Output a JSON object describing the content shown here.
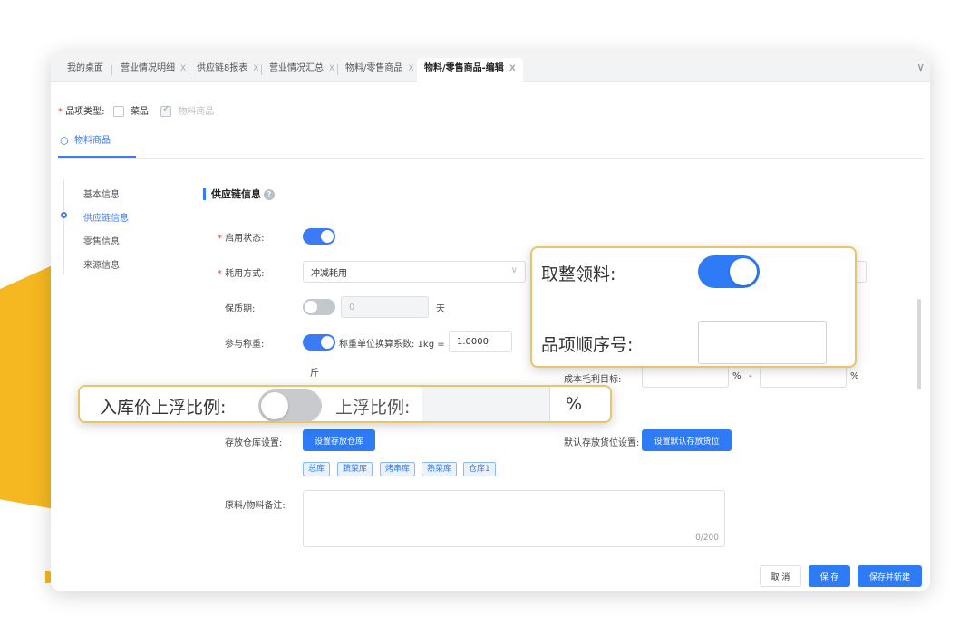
{
  "tabs": [
    {
      "label": "我的桌面",
      "closable": false
    },
    {
      "label": "营业情况明细",
      "closable": true
    },
    {
      "label": "供应链8报表",
      "closable": true
    },
    {
      "label": "营业情况汇总",
      "closable": true
    },
    {
      "label": "物料/零售商品",
      "closable": true
    },
    {
      "label": "物料/零售商品-编辑",
      "closable": true,
      "active": true
    }
  ],
  "tab_close": "X",
  "category": {
    "label": "品项类型:",
    "options": [
      {
        "label": "菜品",
        "checked": false
      },
      {
        "label": "物料商品",
        "checked": true,
        "disabled": true
      }
    ]
  },
  "subtab": {
    "label": "物料商品"
  },
  "anchors": [
    {
      "label": "基本信息"
    },
    {
      "label": "供应链信息",
      "active": true
    },
    {
      "label": "零售信息"
    },
    {
      "label": "来源信息"
    }
  ],
  "section": {
    "title": "供应链信息"
  },
  "form": {
    "enable_status": {
      "label": "启用状态:",
      "on": true
    },
    "consume_mode": {
      "label": "耗用方式:",
      "value": "冲减耗用"
    },
    "shelf_life": {
      "label": "保质期:",
      "on": false,
      "value": "0",
      "unit": "天"
    },
    "weighing": {
      "label": "参与称重:",
      "on": true,
      "factor_label": "称重单位换算系数: 1kg =",
      "factor_value": "1.0000",
      "unit": "斤"
    },
    "cost_margin": {
      "label": "成本毛利目标:",
      "unit1": "%",
      "dash": "-",
      "unit2": "%"
    },
    "warehouse": {
      "label": "存放仓库设置:",
      "button": "设置存放仓库",
      "tags": [
        "总库",
        "蔬菜库",
        "烤串库",
        "熟菜库",
        "仓库1"
      ]
    },
    "default_location": {
      "label": "默认存放货位设置:",
      "button": "设置默认存放货位"
    },
    "remark": {
      "label": "原料/物料备注:",
      "counter": "0/200"
    }
  },
  "footer": {
    "cancel": "取 消",
    "save": "保 存",
    "save_new": "保存并新建"
  },
  "callout_right": {
    "whole_pick_label": "取整领料:",
    "whole_pick_on": true,
    "order_label": "品项顺序号:",
    "order_value": ""
  },
  "callout_left": {
    "inbound_float_label": "入库价上浮比例:",
    "inbound_float_on": false,
    "float_ratio_label": "上浮比例:",
    "float_ratio_value": "",
    "unit": "%"
  },
  "colors": {
    "primary": "#2f7bf5",
    "accent_yellow": "#f6b820",
    "required": "#e2483d"
  }
}
